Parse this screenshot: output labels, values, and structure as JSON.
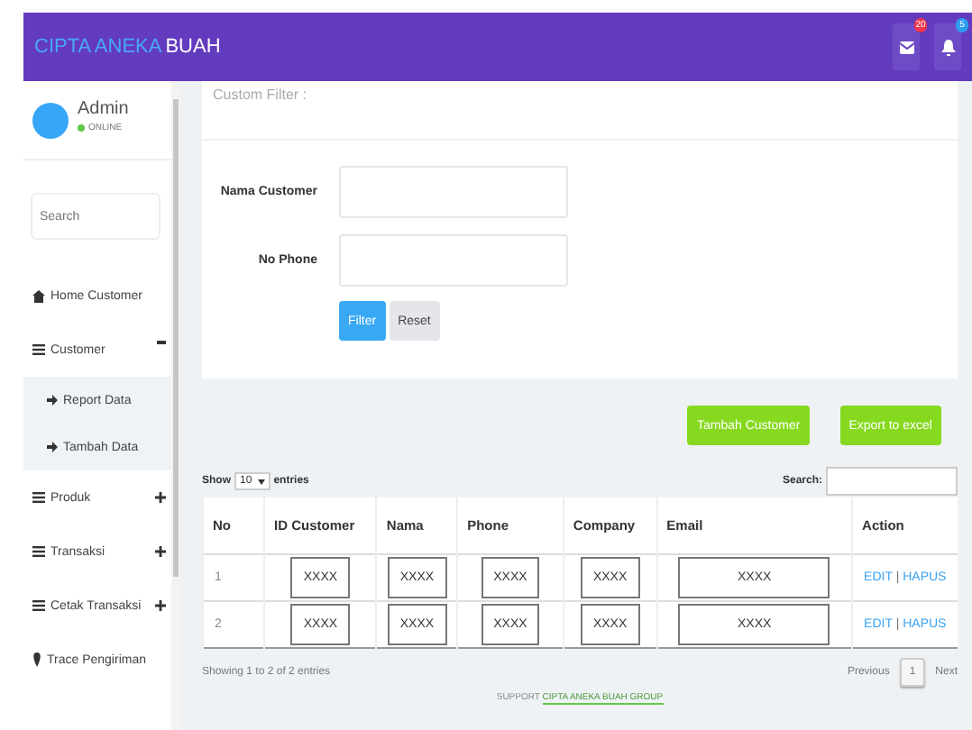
{
  "header": {
    "brand_primary": "CIPTA ANEKA",
    "brand_secondary": "BUAH",
    "notifications": [
      {
        "kind": "mail",
        "count": "20",
        "color": "#f0344a"
      },
      {
        "kind": "bell",
        "count": "5",
        "color": "#2d9cf0"
      }
    ]
  },
  "sidebar": {
    "user": {
      "name": "Admin",
      "status": "ONLINE"
    },
    "search": {
      "placeholder": "Search"
    },
    "items": [
      {
        "label": "Home Customer",
        "kind": "home"
      },
      {
        "label": "Customer",
        "kind": "menu",
        "expanded": true,
        "children": [
          {
            "label": "Report Data"
          },
          {
            "label": "Tambah Data"
          }
        ]
      },
      {
        "label": "Produk",
        "kind": "menu",
        "expanded": false
      },
      {
        "label": "Transaksi",
        "kind": "menu",
        "expanded": false
      },
      {
        "label": "Cetak Transaksi",
        "kind": "menu",
        "expanded": false
      },
      {
        "label": "Trace Pengiriman",
        "kind": "pin"
      }
    ]
  },
  "filter": {
    "title": "Custom Filter :",
    "fields": [
      {
        "label": "Nama Customer"
      },
      {
        "label": "No Phone"
      }
    ],
    "buttons": [
      {
        "label": "Filter",
        "kind": "primary"
      },
      {
        "label": "Reset",
        "kind": "default"
      }
    ]
  },
  "actions": [
    "Tambah Customer",
    "Export to excel"
  ],
  "table": {
    "show_label": "Show",
    "page_size": "10",
    "entries_label": "entries",
    "search_label": "Search:",
    "columns": [
      "No",
      "ID Customer",
      "Nama",
      "Phone",
      "Company",
      "Email",
      "Action"
    ],
    "rows": [
      {
        "cells": [
          "1",
          "XXXX",
          "XXXX",
          "XXXX",
          "XXXX",
          "XXXX"
        ],
        "edit": "EDIT",
        "separator": "|",
        "delete": "HAPUS"
      },
      {
        "cells": [
          "2",
          "XXXX",
          "XXXX",
          "XXXX",
          "XXXX",
          "XXXX"
        ],
        "edit": "EDIT",
        "separator": "|",
        "delete": "HAPUS"
      }
    ],
    "info": "Showing 1 to 2 of 2 entries",
    "pagination": {
      "previous": "Previous",
      "pages": [
        {
          "label": "1",
          "selected": true
        }
      ],
      "next": "Next"
    }
  },
  "footer": {
    "text": "SUPPORT",
    "link": "CIPTA ANEKA BUAH GROUP"
  }
}
